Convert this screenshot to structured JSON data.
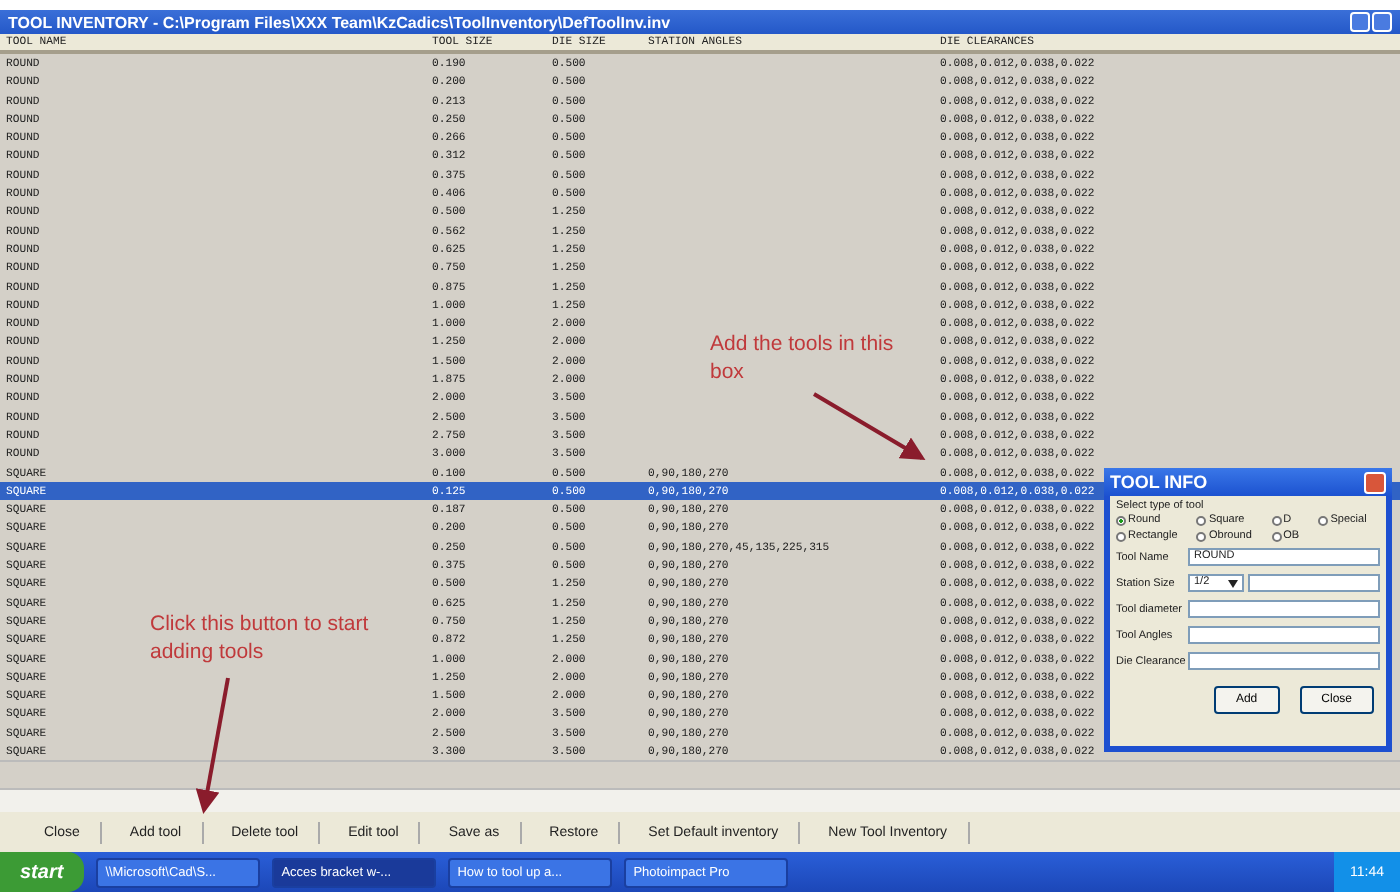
{
  "window": {
    "title": "TOOL INVENTORY - C:\\Program Files\\XXX Team\\KzCadics\\ToolInventory\\DefToolInv.inv"
  },
  "table": {
    "columns": [
      "TOOL NAME",
      "TOOL SIZE",
      "DIE SIZE",
      "STATION ANGLES",
      "DIE CLEARANCES"
    ],
    "rows": [
      {
        "name": "ROUND",
        "size": "0.190",
        "die": "0.500",
        "clearance": "0.008,0.012,0.038,0.022",
        "selected": false
      },
      {
        "name": "ROUND",
        "size": "0.200",
        "die": "0.500",
        "clearance": "0.008,0.012,0.038,0.022",
        "selected": false
      },
      {
        "name": "ROUND",
        "size": "0.213",
        "die": "0.500",
        "clearance": "0.008,0.012,0.038,0.022",
        "selected": false
      },
      {
        "name": "ROUND",
        "size": "0.250",
        "die": "0.500",
        "clearance": "0.008,0.012,0.038,0.022",
        "selected": false
      },
      {
        "name": "ROUND",
        "size": "0.266",
        "die": "0.500",
        "clearance": "0.008,0.012,0.038,0.022",
        "selected": false
      },
      {
        "name": "ROUND",
        "size": "0.312",
        "die": "0.500",
        "clearance": "0.008,0.012,0.038,0.022",
        "selected": false
      },
      {
        "name": "ROUND",
        "size": "0.375",
        "die": "0.500",
        "clearance": "0.008,0.012,0.038,0.022",
        "selected": false
      },
      {
        "name": "ROUND",
        "size": "0.406",
        "die": "0.500",
        "clearance": "0.008,0.012,0.038,0.022",
        "selected": false
      },
      {
        "name": "ROUND",
        "size": "0.500",
        "die": "1.250",
        "clearance": "0.008,0.012,0.038,0.022",
        "selected": false
      },
      {
        "name": "ROUND",
        "size": "0.562",
        "die": "1.250",
        "clearance": "0.008,0.012,0.038,0.022",
        "selected": false
      },
      {
        "name": "ROUND",
        "size": "0.625",
        "die": "1.250",
        "clearance": "0.008,0.012,0.038,0.022",
        "selected": false
      },
      {
        "name": "ROUND",
        "size": "0.750",
        "die": "1.250",
        "clearance": "0.008,0.012,0.038,0.022",
        "selected": false
      },
      {
        "name": "ROUND",
        "size": "0.875",
        "die": "1.250",
        "clearance": "0.008,0.012,0.038,0.022",
        "selected": false
      },
      {
        "name": "ROUND",
        "size": "1.000",
        "die": "1.250",
        "clearance": "0.008,0.012,0.038,0.022",
        "selected": false
      },
      {
        "name": "ROUND",
        "size": "1.000",
        "die": "2.000",
        "clearance": "0.008,0.012,0.038,0.022",
        "selected": false
      },
      {
        "name": "ROUND",
        "size": "1.250",
        "die": "2.000",
        "clearance": "0.008,0.012,0.038,0.022",
        "selected": false
      },
      {
        "name": "ROUND",
        "size": "1.500",
        "die": "2.000",
        "clearance": "0.008,0.012,0.038,0.022",
        "selected": false
      },
      {
        "name": "ROUND",
        "size": "1.875",
        "die": "2.000",
        "clearance": "0.008,0.012,0.038,0.022",
        "selected": false
      },
      {
        "name": "ROUND",
        "size": "2.000",
        "die": "3.500",
        "clearance": "0.008,0.012,0.038,0.022",
        "selected": false
      },
      {
        "name": "ROUND",
        "size": "2.500",
        "die": "3.500",
        "clearance": "0.008,0.012,0.038,0.022",
        "selected": false
      },
      {
        "name": "ROUND",
        "size": "2.750",
        "die": "3.500",
        "clearance": "0.008,0.012,0.038,0.022",
        "selected": false
      },
      {
        "name": "ROUND",
        "size": "3.000",
        "die": "3.500",
        "clearance": "0.008,0.012,0.038,0.022",
        "selected": false
      },
      {
        "name": "SQUARE",
        "size": "0.100",
        "die": "0.500",
        "angles": "0,90,180,270",
        "clearance": "0.008,0.012,0.038,0.022",
        "selected": false
      },
      {
        "name": "SQUARE",
        "size": "0.125",
        "die": "0.500",
        "angles": "0,90,180,270",
        "clearance": "0.008,0.012,0.038,0.022",
        "selected": true
      },
      {
        "name": "SQUARE",
        "size": "0.187",
        "die": "0.500",
        "angles": "0,90,180,270",
        "clearance": "0.008,0.012,0.038,0.022",
        "selected": false
      },
      {
        "name": "SQUARE",
        "size": "0.200",
        "die": "0.500",
        "angles": "0,90,180,270",
        "clearance": "0.008,0.012,0.038,0.022",
        "selected": false
      },
      {
        "name": "SQUARE",
        "size": "0.250",
        "die": "0.500",
        "angles": "0,90,180,270,45,135,225,315",
        "clearance": "0.008,0.012,0.038,0.022",
        "selected": false
      },
      {
        "name": "SQUARE",
        "size": "0.375",
        "die": "0.500",
        "angles": "0,90,180,270",
        "clearance": "0.008,0.012,0.038,0.022",
        "selected": false
      },
      {
        "name": "SQUARE",
        "size": "0.500",
        "die": "1.250",
        "angles": "0,90,180,270",
        "clearance": "0.008,0.012,0.038,0.022",
        "selected": false
      },
      {
        "name": "SQUARE",
        "size": "0.625",
        "die": "1.250",
        "angles": "0,90,180,270",
        "clearance": "0.008,0.012,0.038,0.022",
        "selected": false
      },
      {
        "name": "SQUARE",
        "size": "0.750",
        "die": "1.250",
        "angles": "0,90,180,270",
        "clearance": "0.008,0.012,0.038,0.022",
        "selected": false
      },
      {
        "name": "SQUARE",
        "size": "0.872",
        "die": "1.250",
        "angles": "0,90,180,270",
        "clearance": "0.008,0.012,0.038,0.022",
        "selected": false
      },
      {
        "name": "SQUARE",
        "size": "1.000",
        "die": "2.000",
        "angles": "0,90,180,270",
        "clearance": "0.008,0.012,0.038,0.022",
        "selected": false
      },
      {
        "name": "SQUARE",
        "size": "1.250",
        "die": "2.000",
        "angles": "0,90,180,270",
        "clearance": "0.008,0.012,0.038,0.022",
        "selected": false
      },
      {
        "name": "SQUARE",
        "size": "1.500",
        "die": "2.000",
        "angles": "0,90,180,270",
        "clearance": "0.008,0.012,0.038,0.022",
        "selected": false
      },
      {
        "name": "SQUARE",
        "size": "2.000",
        "die": "3.500",
        "angles": "0,90,180,270",
        "clearance": "0.008,0.012,0.038,0.022",
        "selected": false
      },
      {
        "name": "SQUARE",
        "size": "2.500",
        "die": "3.500",
        "angles": "0,90,180,270",
        "clearance": "0.008,0.012,0.038,0.022",
        "selected": false
      },
      {
        "name": "SQUARE",
        "size": "3.300",
        "die": "3.500",
        "angles": "0,90,180,270",
        "clearance": "0.008,0.012,0.038,0.022",
        "selected": false
      }
    ]
  },
  "buttons": [
    "Close",
    "Add tool",
    "Delete tool",
    "Edit tool",
    "Save as",
    "Restore",
    "Set Default inventory",
    "New Tool Inventory"
  ],
  "dialog": {
    "title": "TOOL INFO",
    "group_label": "Select type of tool",
    "tool_types": [
      {
        "label": "Round",
        "selected": true
      },
      {
        "label": "Square",
        "selected": false
      },
      {
        "label": "D",
        "selected": false
      },
      {
        "label": "Special",
        "selected": false
      },
      {
        "label": "Rectangle",
        "selected": false
      },
      {
        "label": "Obround",
        "selected": false
      },
      {
        "label": "OB",
        "selected": false
      }
    ],
    "fields": [
      {
        "label": "Tool Name",
        "value": "ROUND",
        "kind": "text"
      },
      {
        "label": "Station Size",
        "value": "1/2",
        "kind": "dropdown"
      },
      {
        "label": "Tool diameter",
        "kind": "text"
      },
      {
        "label": "Tool Angles",
        "kind": "text"
      },
      {
        "label": "Die Clearance",
        "kind": "text"
      }
    ],
    "buttons": [
      "Add",
      "Close"
    ]
  },
  "annotations": [
    {
      "text": "Add the tools in this box"
    },
    {
      "text": "Click this button to start adding tools"
    }
  ],
  "taskbar": {
    "start": "start",
    "items": [
      {
        "label": "\\\\Microsoft\\Cad\\S...",
        "selected": false
      },
      {
        "label": "Acces bracket w-...",
        "selected": true
      },
      {
        "label": "How to tool up a...",
        "selected": false
      },
      {
        "label": "Photoimpact Pro",
        "selected": false
      }
    ],
    "clock": "11:44"
  }
}
